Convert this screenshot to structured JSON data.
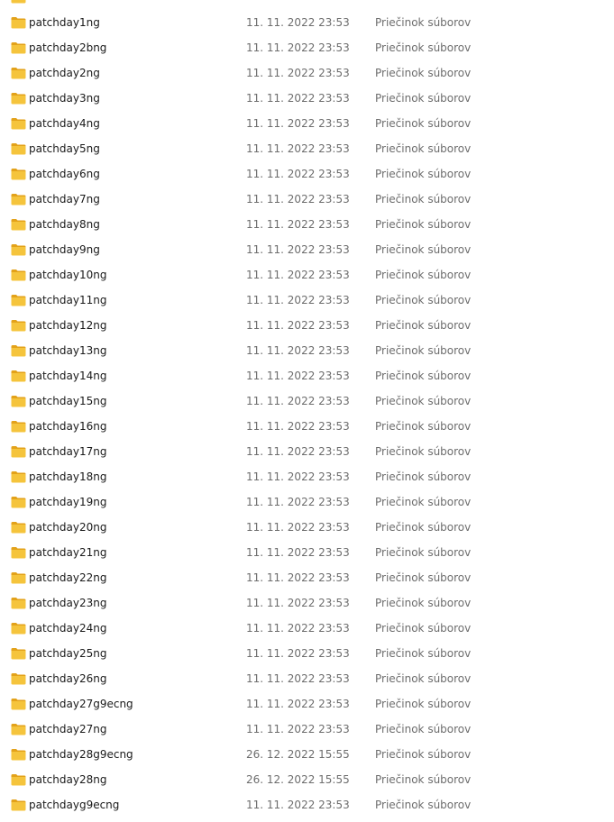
{
  "colors": {
    "folder_body": "#f5c43c",
    "folder_tab": "#e3a21a",
    "name_text": "#1a1a1a",
    "meta_text": "#6d6d6d"
  },
  "icon": "folder-icon",
  "rows": [
    {
      "name": "patchday1ng",
      "date": "11. 11. 2022 23:53",
      "type": "Priečinok súborov"
    },
    {
      "name": "patchday2bng",
      "date": "11. 11. 2022 23:53",
      "type": "Priečinok súborov"
    },
    {
      "name": "patchday2ng",
      "date": "11. 11. 2022 23:53",
      "type": "Priečinok súborov"
    },
    {
      "name": "patchday3ng",
      "date": "11. 11. 2022 23:53",
      "type": "Priečinok súborov"
    },
    {
      "name": "patchday4ng",
      "date": "11. 11. 2022 23:53",
      "type": "Priečinok súborov"
    },
    {
      "name": "patchday5ng",
      "date": "11. 11. 2022 23:53",
      "type": "Priečinok súborov"
    },
    {
      "name": "patchday6ng",
      "date": "11. 11. 2022 23:53",
      "type": "Priečinok súborov"
    },
    {
      "name": "patchday7ng",
      "date": "11. 11. 2022 23:53",
      "type": "Priečinok súborov"
    },
    {
      "name": "patchday8ng",
      "date": "11. 11. 2022 23:53",
      "type": "Priečinok súborov"
    },
    {
      "name": "patchday9ng",
      "date": "11. 11. 2022 23:53",
      "type": "Priečinok súborov"
    },
    {
      "name": "patchday10ng",
      "date": "11. 11. 2022 23:53",
      "type": "Priečinok súborov"
    },
    {
      "name": "patchday11ng",
      "date": "11. 11. 2022 23:53",
      "type": "Priečinok súborov"
    },
    {
      "name": "patchday12ng",
      "date": "11. 11. 2022 23:53",
      "type": "Priečinok súborov"
    },
    {
      "name": "patchday13ng",
      "date": "11. 11. 2022 23:53",
      "type": "Priečinok súborov"
    },
    {
      "name": "patchday14ng",
      "date": "11. 11. 2022 23:53",
      "type": "Priečinok súborov"
    },
    {
      "name": "patchday15ng",
      "date": "11. 11. 2022 23:53",
      "type": "Priečinok súborov"
    },
    {
      "name": "patchday16ng",
      "date": "11. 11. 2022 23:53",
      "type": "Priečinok súborov"
    },
    {
      "name": "patchday17ng",
      "date": "11. 11. 2022 23:53",
      "type": "Priečinok súborov"
    },
    {
      "name": "patchday18ng",
      "date": "11. 11. 2022 23:53",
      "type": "Priečinok súborov"
    },
    {
      "name": "patchday19ng",
      "date": "11. 11. 2022 23:53",
      "type": "Priečinok súborov"
    },
    {
      "name": "patchday20ng",
      "date": "11. 11. 2022 23:53",
      "type": "Priečinok súborov"
    },
    {
      "name": "patchday21ng",
      "date": "11. 11. 2022 23:53",
      "type": "Priečinok súborov"
    },
    {
      "name": "patchday22ng",
      "date": "11. 11. 2022 23:53",
      "type": "Priečinok súborov"
    },
    {
      "name": "patchday23ng",
      "date": "11. 11. 2022 23:53",
      "type": "Priečinok súborov"
    },
    {
      "name": "patchday24ng",
      "date": "11. 11. 2022 23:53",
      "type": "Priečinok súborov"
    },
    {
      "name": "patchday25ng",
      "date": "11. 11. 2022 23:53",
      "type": "Priečinok súborov"
    },
    {
      "name": "patchday26ng",
      "date": "11. 11. 2022 23:53",
      "type": "Priečinok súborov"
    },
    {
      "name": "patchday27g9ecng",
      "date": "11. 11. 2022 23:53",
      "type": "Priečinok súborov"
    },
    {
      "name": "patchday27ng",
      "date": "11. 11. 2022 23:53",
      "type": "Priečinok súborov"
    },
    {
      "name": "patchday28g9ecng",
      "date": "26. 12. 2022 15:55",
      "type": "Priečinok súborov"
    },
    {
      "name": "patchday28ng",
      "date": "26. 12. 2022 15:55",
      "type": "Priečinok súborov"
    },
    {
      "name": "patchdayg9ecng",
      "date": "11. 11. 2022 23:53",
      "type": "Priečinok súborov"
    }
  ]
}
